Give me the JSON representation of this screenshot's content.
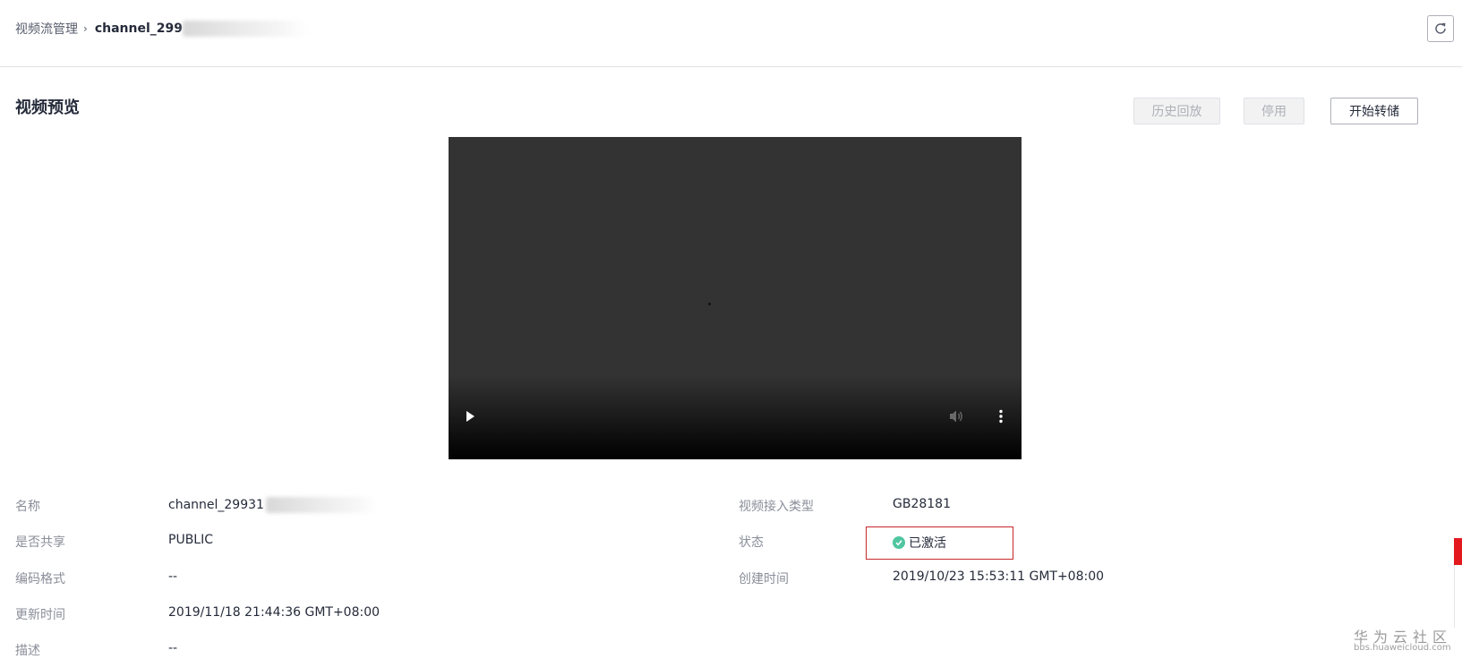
{
  "breadcrumb": {
    "parent": "视频流管理",
    "separator": "›",
    "current": "channel_299"
  },
  "header": {
    "refresh_icon": "refresh-icon"
  },
  "section": {
    "title": "视频预览"
  },
  "actions": {
    "history_playback": "历史回放",
    "disable": "停用",
    "start_storage": "开始转储"
  },
  "player": {
    "icons": {
      "play": "play-icon",
      "volume": "volume-icon",
      "more": "more-vertical-icon"
    }
  },
  "details": {
    "name": {
      "label": "名称",
      "value": "channel_29931"
    },
    "shared": {
      "label": "是否共享",
      "value": "PUBLIC"
    },
    "encoding": {
      "label": "编码格式",
      "value": "--"
    },
    "updated": {
      "label": "更新时间",
      "value": "2019/11/18 21:44:36 GMT+08:00"
    },
    "description": {
      "label": "描述",
      "value": "--"
    },
    "access_type": {
      "label": "视频接入类型",
      "value": "GB28181"
    },
    "status": {
      "label": "状态",
      "value": "已激活",
      "color": "#50c6a0"
    },
    "created": {
      "label": "创建时间",
      "value": "2019/10/23 15:53:11 GMT+08:00"
    }
  },
  "watermark": {
    "text": "华为云社区",
    "url": "bbs.huaweicloud.com"
  },
  "colors": {
    "highlight_border": "#c8282d",
    "edge_red": "#e3191e"
  }
}
